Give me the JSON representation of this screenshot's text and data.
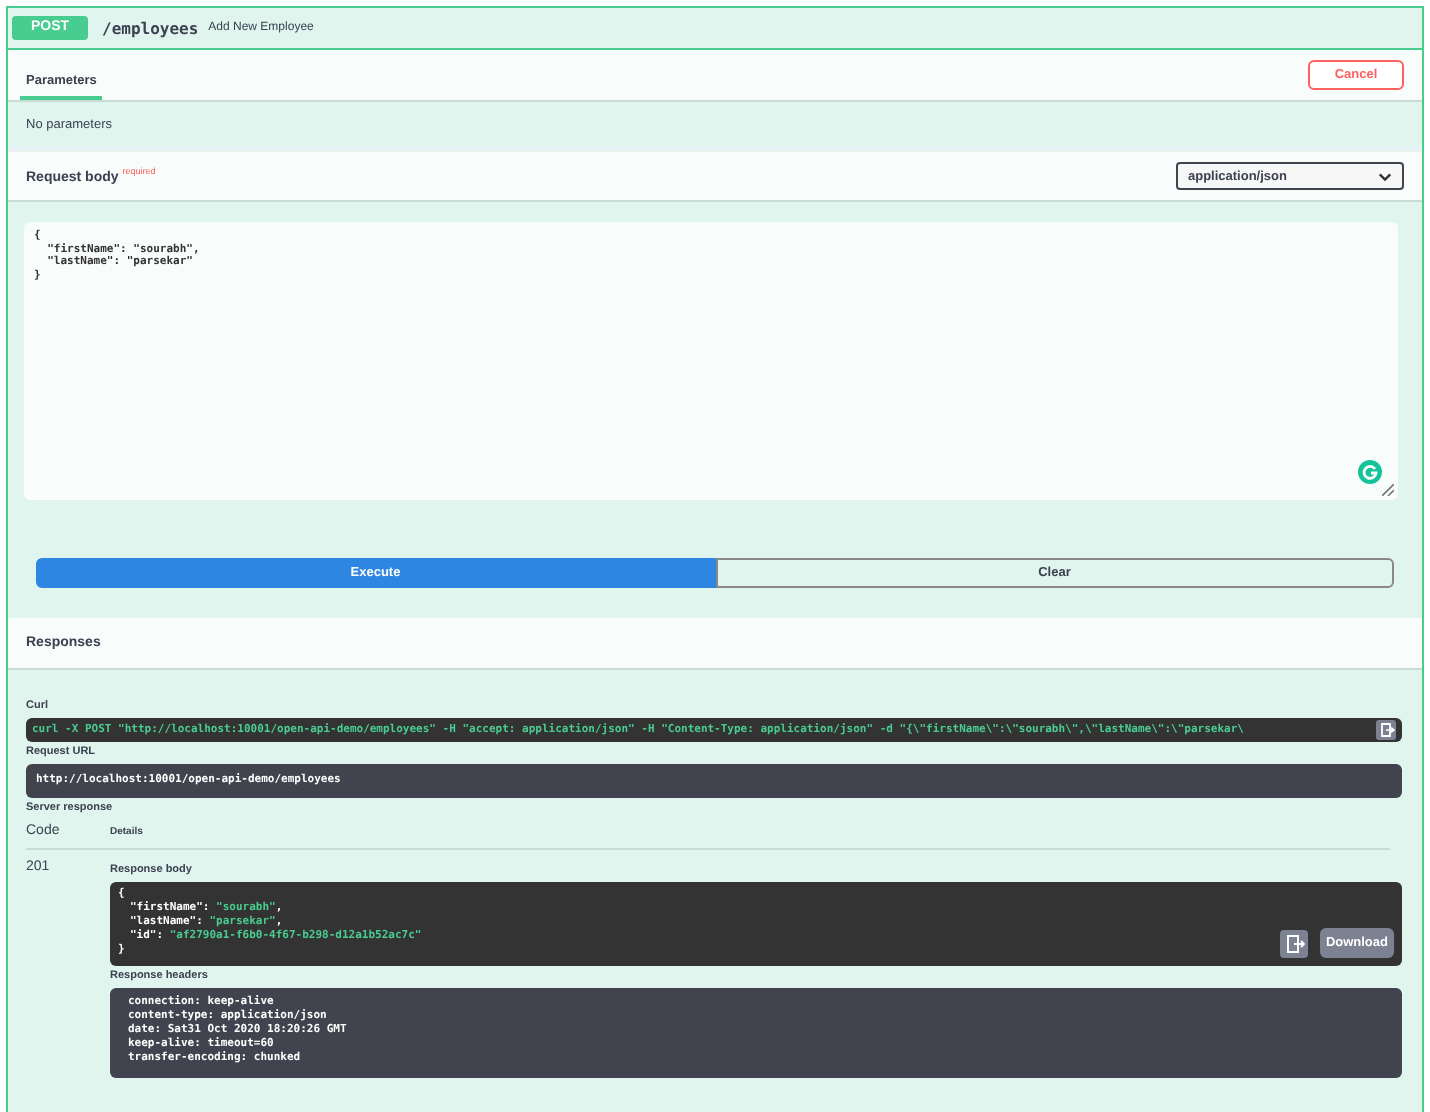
{
  "operation": {
    "method": "POST",
    "path": "/employees",
    "summary": "Add New Employee"
  },
  "tabs": [
    {
      "label": "Parameters",
      "selected": true
    }
  ],
  "cancel_button": "Cancel",
  "parameters_message": "No parameters",
  "request_body": {
    "label": "Request body",
    "required": "required",
    "content_type": "application/json",
    "lines": [
      "{",
      "  \"firstName\": \"sourabh\",",
      "  \"lastName\": \"parsekar\"",
      "}"
    ]
  },
  "buttons": [
    {
      "label": "Execute",
      "kind": "primary"
    },
    {
      "label": "Clear",
      "kind": "secondary"
    }
  ],
  "responses_title": "Responses",
  "curl": {
    "label": "Curl",
    "command": "curl -X POST \"http://localhost:10001/open-api-demo/employees\" -H  \"accept: application/json\" -H  \"Content-Type: application/json\" -d \"{\\\"firstName\\\":\\\"sourabh\\\",\\\"lastName\\\":\\\"parsekar\\"
  },
  "request_url": {
    "label": "Request URL",
    "url": "http://localhost:10001/open-api-demo/employees"
  },
  "server_response": {
    "label": "Server response",
    "columns": [
      "Code",
      "Details"
    ],
    "code": "201",
    "body_label": "Response body",
    "body": {
      "open": "{",
      "close": "}",
      "fields": [
        {
          "key": "\"firstName\"",
          "sep": ": ",
          "value": "\"sourabh\"",
          "end": ","
        },
        {
          "key": "\"lastName\"",
          "sep": ": ",
          "value": "\"parsekar\"",
          "end": ","
        },
        {
          "key": "\"id\"",
          "sep": ": ",
          "value": "\"af2790a1-f6b0-4f67-b298-d12a1b52ac7c\""
        }
      ]
    },
    "download": "Download",
    "headers_label": "Response headers",
    "headers": [
      "connection: keep-alive",
      "content-type: application/json",
      "date: Sat31 Oct 2020 18:20:26 GMT",
      "keep-alive: timeout=60",
      "transfer-encoding: chunked"
    ]
  }
}
